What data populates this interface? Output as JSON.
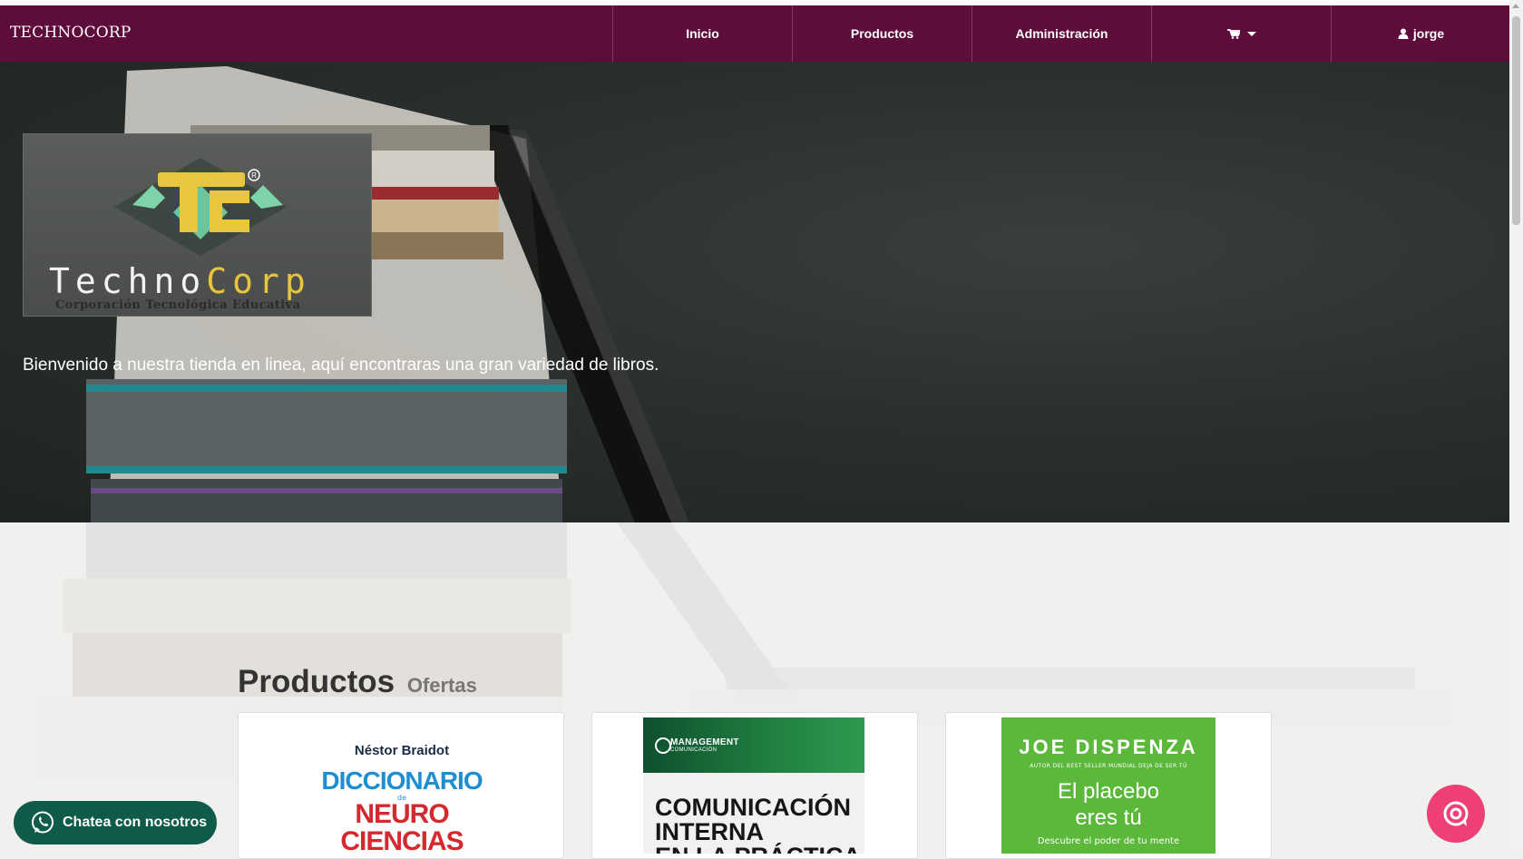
{
  "navbar": {
    "brand": "TECHNOCORP",
    "items": [
      {
        "label": "Inicio"
      },
      {
        "label": "Productos"
      },
      {
        "label": "Administración"
      },
      {
        "label": "",
        "icon": "cart-icon"
      },
      {
        "label": "jorge",
        "icon": "user-icon"
      }
    ]
  },
  "hero": {
    "logo_mark": "TC",
    "logo_name_a": "Techno",
    "logo_name_b": "Corp",
    "logo_sub": "Corporación Tecnológica Educativa",
    "welcome": "Bienvenido a nuestra tienda en linea, aquí encontraras una gran variedad de libros."
  },
  "section": {
    "title": "Productos",
    "subtitle": "Ofertas"
  },
  "products": [
    {
      "author": "Néstor Braidot",
      "title_a": "DICCIONARIO",
      "title_de": "de",
      "title_b": "NEURO",
      "title_c": "CIENCIAS"
    },
    {
      "brand": "MANAGEMENT",
      "brand_sub": "COMUNICACIÓN",
      "title_a": "COMUNICACIÓN",
      "title_b": "INTERNA",
      "title_c": "EN LA PRÁCTICA"
    },
    {
      "author": "JOE DISPENZA",
      "tagline": "AUTOR DEL BEST SELLER MUNDIAL DEJA DE SER TÚ",
      "title_a": "El placebo",
      "title_b": "eres tú",
      "desc": "Descubre el poder de tu mente"
    }
  ],
  "whatsapp": {
    "label": "Chatea con nosotros"
  },
  "colors": {
    "navbar": "#5e0c3a",
    "whatsapp": "#0e5b49",
    "chat": "#ee3f77"
  }
}
